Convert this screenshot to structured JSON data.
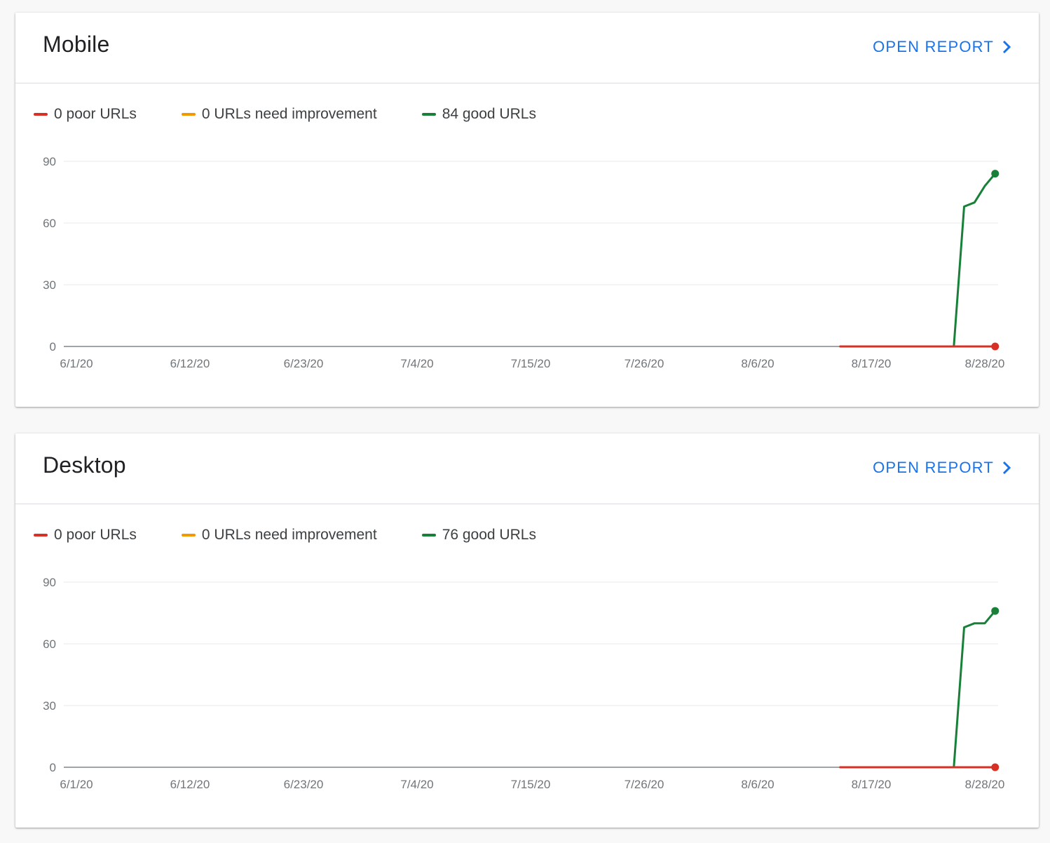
{
  "colors": {
    "poor": "#d93025",
    "needs_improvement": "#f29900",
    "good": "#188038",
    "link": "#1a73e8"
  },
  "cards": [
    {
      "title": "Mobile",
      "open_report": "OPEN REPORT",
      "legend": [
        "0 poor URLs",
        "0 URLs need improvement",
        "84 good URLs"
      ]
    },
    {
      "title": "Desktop",
      "open_report": "OPEN REPORT",
      "legend": [
        "0 poor URLs",
        "0 URLs need improvement",
        "76 good URLs"
      ]
    }
  ],
  "chart_data": [
    {
      "type": "line",
      "x_ticks": [
        "6/1/20",
        "6/12/20",
        "6/23/20",
        "7/4/20",
        "7/15/20",
        "7/26/20",
        "8/6/20",
        "8/17/20",
        "8/28/20"
      ],
      "y_ticks": [
        0,
        30,
        60,
        90
      ],
      "ylim": [
        0,
        90
      ],
      "xlim": [
        "2020-06-01",
        "2020-08-29"
      ],
      "grid": true,
      "series": [
        {
          "name": "poor URLs",
          "color": "#d93025",
          "x": [
            "2020-08-14",
            "2020-08-29"
          ],
          "y": [
            0,
            0
          ]
        },
        {
          "name": "URLs need improvement",
          "color": "#f29900",
          "x": [
            "2020-08-14",
            "2020-08-29"
          ],
          "y": [
            0,
            0
          ]
        },
        {
          "name": "good URLs",
          "color": "#188038",
          "x": [
            "2020-08-14",
            "2020-08-25",
            "2020-08-26",
            "2020-08-27",
            "2020-08-28",
            "2020-08-29"
          ],
          "y": [
            0,
            0,
            68,
            70,
            78,
            84
          ]
        }
      ]
    },
    {
      "type": "line",
      "x_ticks": [
        "6/1/20",
        "6/12/20",
        "6/23/20",
        "7/4/20",
        "7/15/20",
        "7/26/20",
        "8/6/20",
        "8/17/20",
        "8/28/20"
      ],
      "y_ticks": [
        0,
        30,
        60,
        90
      ],
      "ylim": [
        0,
        90
      ],
      "xlim": [
        "2020-06-01",
        "2020-08-29"
      ],
      "grid": true,
      "series": [
        {
          "name": "poor URLs",
          "color": "#d93025",
          "x": [
            "2020-08-14",
            "2020-08-29"
          ],
          "y": [
            0,
            0
          ]
        },
        {
          "name": "URLs need improvement",
          "color": "#f29900",
          "x": [
            "2020-08-14",
            "2020-08-29"
          ],
          "y": [
            0,
            0
          ]
        },
        {
          "name": "good URLs",
          "color": "#188038",
          "x": [
            "2020-08-14",
            "2020-08-25",
            "2020-08-26",
            "2020-08-27",
            "2020-08-28",
            "2020-08-29"
          ],
          "y": [
            0,
            0,
            68,
            70,
            70,
            76
          ]
        }
      ]
    }
  ]
}
